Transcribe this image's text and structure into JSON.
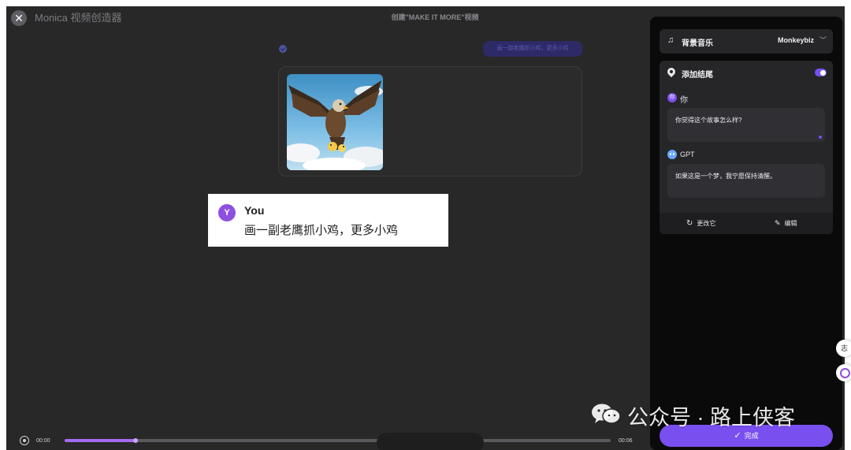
{
  "app": {
    "title": "Monica 视频创造器",
    "video_title": "创建\"MAKE IT MORE\"视频",
    "close_icon": "close-icon"
  },
  "preview": {
    "prompt_pill": "画一副老鹰抓小鸡，更多小鸡",
    "image_subject": "eagle-catching-chicks"
  },
  "caption": {
    "avatar": "Y",
    "name": "You",
    "text": "画一副老鹰抓小鸡，更多小鸡"
  },
  "timeline": {
    "current_time": "00:00",
    "total_time": "00:06",
    "progress": 0.13
  },
  "panel": {
    "music_label": "背景音乐",
    "music_value": "Monkeybiz",
    "ending_label": "添加结尾",
    "ending_enabled": true,
    "you_label": "你",
    "you_avatar": "你",
    "you_message": "你觉得这个故事怎么样?",
    "gpt_label": "GPT",
    "gpt_message": "如果这是一个梦，我宁愿保持清醒。",
    "regenerate_label": "更改它",
    "edit_label": "编辑",
    "done_label": "完成"
  },
  "side_widgets": {
    "widget_1_glyph": "志"
  },
  "watermark": {
    "text": "公众号 · 路上侠客"
  },
  "colors": {
    "accent": "#7a4ff0",
    "canvas_bg": "#282828",
    "panel_bg": "#0a0a0b"
  }
}
